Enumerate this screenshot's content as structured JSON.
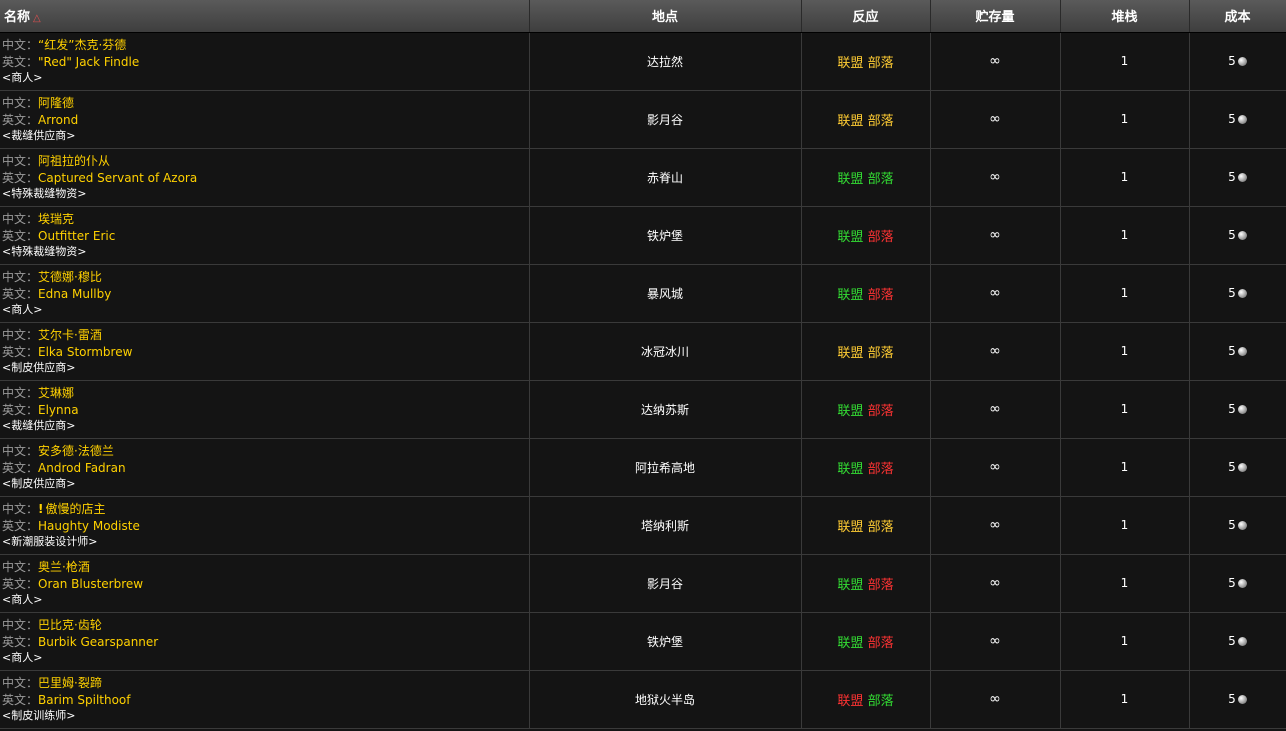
{
  "columns": {
    "name": "名称",
    "location": "地点",
    "react": "反应",
    "stock": "贮存量",
    "stack": "堆栈",
    "cost": "成本"
  },
  "labels": {
    "cn": "中文：",
    "en": "英文："
  },
  "colors": {
    "yellow": "#ffcc33",
    "green": "#33dd33",
    "red": "#ff3333",
    "name": "#ffd100"
  },
  "rows": [
    {
      "cn": "“红发”杰克·芬德",
      "en": "\"Red\" Jack Findle",
      "title": "<商人>",
      "location": "达拉然",
      "alliance": "联盟",
      "horde": "部落",
      "alliance_color": "yellow",
      "horde_color": "yellow",
      "stock": "∞",
      "stack": "1",
      "cost": "5"
    },
    {
      "cn": "阿隆德",
      "en": "Arrond",
      "title": "<裁缝供应商>",
      "location": "影月谷",
      "alliance": "联盟",
      "horde": "部落",
      "alliance_color": "yellow",
      "horde_color": "yellow",
      "stock": "∞",
      "stack": "1",
      "cost": "5"
    },
    {
      "cn": "阿祖拉的仆从",
      "en": "Captured Servant of Azora",
      "title": "<特殊裁缝物资>",
      "location": "赤脊山",
      "alliance": "联盟",
      "horde": "部落",
      "alliance_color": "green",
      "horde_color": "green",
      "stock": "∞",
      "stack": "1",
      "cost": "5"
    },
    {
      "cn": "埃瑞克",
      "en": "Outfitter Eric",
      "title": "<特殊裁缝物资>",
      "location": "铁炉堡",
      "alliance": "联盟",
      "horde": "部落",
      "alliance_color": "green",
      "horde_color": "red",
      "stock": "∞",
      "stack": "1",
      "cost": "5"
    },
    {
      "cn": "艾德娜·穆比",
      "en": "Edna Mullby",
      "title": "<商人>",
      "location": "暴风城",
      "alliance": "联盟",
      "horde": "部落",
      "alliance_color": "green",
      "horde_color": "red",
      "stock": "∞",
      "stack": "1",
      "cost": "5"
    },
    {
      "cn": "艾尔卡·雷酒",
      "en": "Elka Stormbrew",
      "title": "<制皮供应商>",
      "location": "冰冠冰川",
      "alliance": "联盟",
      "horde": "部落",
      "alliance_color": "yellow",
      "horde_color": "yellow",
      "stock": "∞",
      "stack": "1",
      "cost": "5"
    },
    {
      "cn": "艾琳娜",
      "en": "Elynna",
      "title": "<裁缝供应商>",
      "location": "达纳苏斯",
      "alliance": "联盟",
      "horde": "部落",
      "alliance_color": "green",
      "horde_color": "red",
      "stock": "∞",
      "stack": "1",
      "cost": "5"
    },
    {
      "cn": "安多德·法德兰",
      "en": "Androd Fadran",
      "title": "<制皮供应商>",
      "location": "阿拉希高地",
      "alliance": "联盟",
      "horde": "部落",
      "alliance_color": "green",
      "horde_color": "red",
      "stock": "∞",
      "stack": "1",
      "cost": "5"
    },
    {
      "cn": "傲慢的店主",
      "en": "Haughty Modiste",
      "title": "<新潮服装设计师>",
      "location": "塔纳利斯",
      "alliance": "联盟",
      "horde": "部落",
      "alliance_color": "yellow",
      "horde_color": "yellow",
      "stock": "∞",
      "stack": "1",
      "cost": "5",
      "quest": "!"
    },
    {
      "cn": "奥兰·枪酒",
      "en": "Oran Blusterbrew",
      "title": "<商人>",
      "location": "影月谷",
      "alliance": "联盟",
      "horde": "部落",
      "alliance_color": "green",
      "horde_color": "red",
      "stock": "∞",
      "stack": "1",
      "cost": "5"
    },
    {
      "cn": "巴比克·齿轮",
      "en": "Burbik Gearspanner",
      "title": "<商人>",
      "location": "铁炉堡",
      "alliance": "联盟",
      "horde": "部落",
      "alliance_color": "green",
      "horde_color": "red",
      "stock": "∞",
      "stack": "1",
      "cost": "5"
    },
    {
      "cn": "巴里姆·裂蹄",
      "en": "Barim Spilthoof",
      "title": "<制皮训练师>",
      "location": "地狱火半岛",
      "alliance": "联盟",
      "horde": "部落",
      "alliance_color": "red",
      "horde_color": "green",
      "stock": "∞",
      "stack": "1",
      "cost": "5"
    }
  ]
}
